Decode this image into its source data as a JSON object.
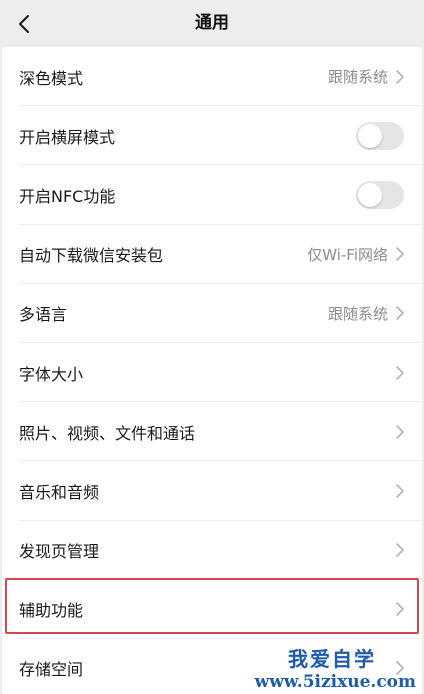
{
  "header": {
    "title": "通用"
  },
  "items": [
    {
      "label": "深色模式",
      "value": "跟随系统"
    },
    {
      "label": "开启横屏模式",
      "toggle": false
    },
    {
      "label": "开启NFC功能",
      "toggle": false
    },
    {
      "label": "自动下载微信安装包",
      "value": "仅Wi-Fi网络"
    },
    {
      "label": "多语言",
      "value": "跟随系统"
    },
    {
      "label": "字体大小"
    },
    {
      "label": "照片、视频、文件和通话"
    },
    {
      "label": "音乐和音频"
    },
    {
      "label": "发现页管理"
    },
    {
      "label": "辅助功能",
      "highlighted": true
    },
    {
      "label": "存储空间"
    }
  ],
  "watermark": {
    "line1": "我爱自学",
    "line2": "www.5izixue.com"
  },
  "colors": {
    "highlight": "#d7464e",
    "watermark": "#1d5aa8",
    "toggle_off": "#e5e5e5"
  }
}
